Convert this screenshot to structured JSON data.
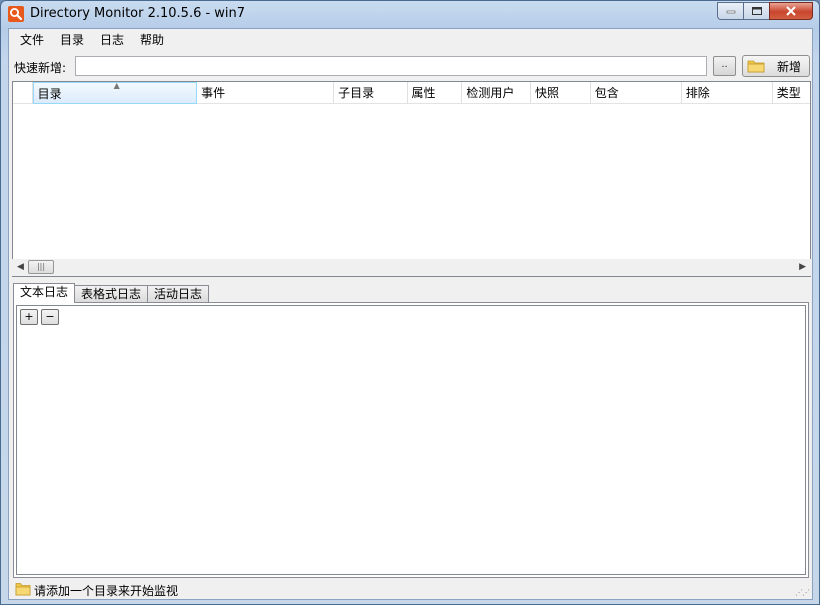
{
  "window": {
    "title": "Directory Monitor 2.10.5.6 - win7"
  },
  "menu": [
    "文件",
    "目录",
    "日志",
    "帮助"
  ],
  "quick_add": {
    "label": "快速新增:",
    "input_value": "",
    "browse_label": "..",
    "add_label": "新增"
  },
  "grid": {
    "columns": [
      {
        "label": "目录",
        "sorted": true
      },
      {
        "label": "事件"
      },
      {
        "label": "子目录"
      },
      {
        "label": "属性"
      },
      {
        "label": "检测用户"
      },
      {
        "label": "快照"
      },
      {
        "label": "包含"
      },
      {
        "label": "排除"
      },
      {
        "label": "类型"
      }
    ],
    "rows": []
  },
  "tabs": [
    {
      "label": "文本日志",
      "active": true
    },
    {
      "label": "表格式日志",
      "active": false
    },
    {
      "label": "活动日志",
      "active": false
    }
  ],
  "log": {
    "zoom_in": "+",
    "zoom_out": "−"
  },
  "status": {
    "text": "请添加一个目录来开始监视"
  },
  "colors": {
    "app_icon": "#e85a1b",
    "close_button": "#c9452e",
    "folder": "#f0c64a"
  }
}
